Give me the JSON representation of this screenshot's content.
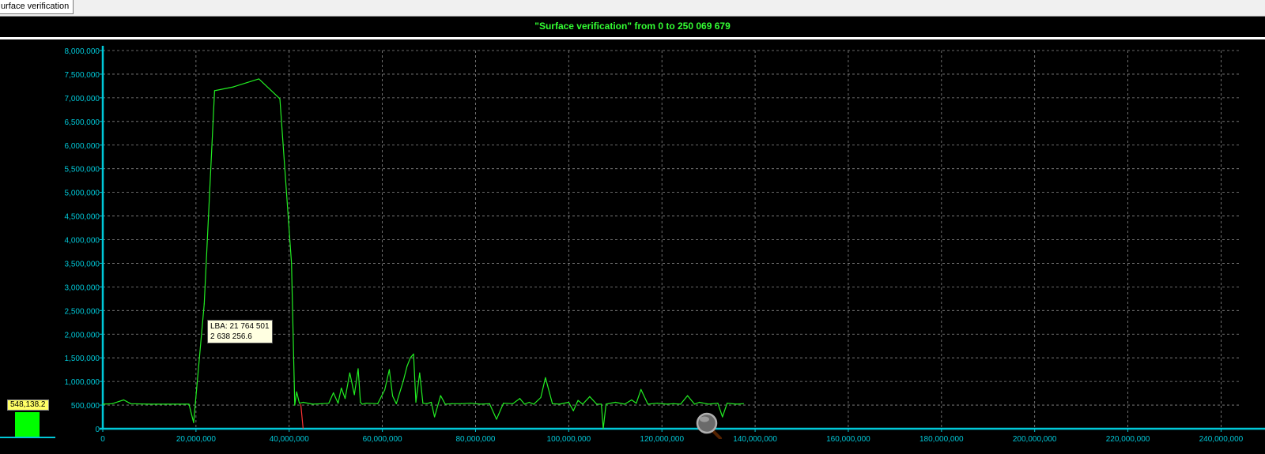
{
  "tab": {
    "label": "urface verification"
  },
  "title": "\"Surface verification\" from 0 to 250 069 679",
  "side_indicator": {
    "value_label": "548,138.2",
    "value": 548138.2
  },
  "tooltip": {
    "line1": "LBA: 21 764 501",
    "line2": "2 638 256.6"
  },
  "colors": {
    "line": "#22ee22",
    "axis": "#00c8d8",
    "tick_text": "#00c8d8",
    "grid": "#8a8a8a",
    "accent": "#ff3333"
  },
  "chart_data": {
    "type": "line",
    "title": "\"Surface verification\" from 0 to 250 069 679",
    "xlim": [
      0,
      244000000
    ],
    "ylim": [
      0,
      8000000
    ],
    "grid": true,
    "x_ticks": [
      0,
      20000000,
      40000000,
      60000000,
      80000000,
      100000000,
      120000000,
      140000000,
      160000000,
      180000000,
      200000000,
      220000000,
      240000000
    ],
    "x_tick_labels": [
      "0",
      "20,000,000",
      "40,000,000",
      "60,000,000",
      "80,000,000",
      "100,000,000",
      "120,000,000",
      "140,000,000",
      "160,000,000",
      "180,000,000",
      "200,000,000",
      "220,000,000",
      "240,000,000"
    ],
    "y_ticks": [
      0,
      500000,
      1000000,
      1500000,
      2000000,
      2500000,
      3000000,
      3500000,
      4000000,
      4500000,
      5000000,
      5500000,
      6000000,
      6500000,
      7000000,
      7500000,
      8000000
    ],
    "y_tick_labels": [
      "0",
      "500,000",
      "1,000,000",
      "1,500,000",
      "2,000,000",
      "2,500,000",
      "3,000,000",
      "3,500,000",
      "4,000,000",
      "4,500,000",
      "5,000,000",
      "5,500,000",
      "6,000,000",
      "6,500,000",
      "7,000,000",
      "7,500,000",
      "8,000,000"
    ],
    "series": [
      {
        "x": [
          0,
          2000000,
          4500000,
          6000000,
          10000000,
          15000000,
          18000000,
          18500000,
          19500000,
          21764501,
          24000000,
          28000000,
          33500000,
          38000000,
          40500000,
          41200000,
          41600000,
          42200000,
          43000000,
          45000000,
          47000000,
          48500000,
          49500000,
          50500000,
          51200000,
          52000000,
          53000000,
          54000000,
          54800000,
          55300000,
          55700000,
          56500000,
          59000000,
          60500000,
          61500000,
          62200000,
          63000000,
          64500000,
          65300000,
          66000000,
          66700000,
          67200000,
          68000000,
          68700000,
          69500000,
          70500000,
          71200000,
          72500000,
          73500000,
          75000000,
          77000000,
          79000000,
          81000000,
          83000000,
          84500000,
          86000000,
          88000000,
          89500000,
          90500000,
          91500000,
          92500000,
          94000000,
          95000000,
          96500000,
          98000000,
          100000000,
          101000000,
          102000000,
          103000000,
          104500000,
          106000000,
          107000000,
          107400000,
          108000000,
          110000000,
          112000000,
          113500000,
          114500000,
          115500000,
          117000000,
          119000000,
          121000000,
          122500000,
          124000000,
          125500000,
          127000000,
          128000000,
          130000000,
          132000000,
          133000000,
          134000000,
          136000000,
          137500000
        ],
        "y": [
          520000,
          530000,
          610000,
          530000,
          520000,
          520000,
          520000,
          520000,
          130000,
          2638256,
          7150000,
          7230000,
          7400000,
          6980000,
          3500000,
          500000,
          780000,
          540000,
          560000,
          520000,
          530000,
          540000,
          760000,
          540000,
          860000,
          640000,
          1180000,
          720000,
          1270000,
          560000,
          520000,
          540000,
          530000,
          820000,
          1250000,
          690000,
          530000,
          1010000,
          1320000,
          1500000,
          1580000,
          560000,
          1180000,
          540000,
          530000,
          560000,
          250000,
          700000,
          520000,
          530000,
          530000,
          540000,
          520000,
          530000,
          200000,
          540000,
          530000,
          640000,
          520000,
          560000,
          520000,
          660000,
          1080000,
          530000,
          520000,
          560000,
          380000,
          600000,
          520000,
          680000,
          520000,
          520000,
          0,
          520000,
          560000,
          520000,
          610000,
          540000,
          830000,
          520000,
          540000,
          520000,
          530000,
          520000,
          700000,
          520000,
          560000,
          520000,
          540000,
          250000,
          540000,
          520000,
          530000
        ]
      }
    ],
    "highlight": {
      "x": 43000000,
      "color": "#ff3333"
    },
    "marker": {
      "x": 21764501,
      "y": 2638256.6
    }
  }
}
